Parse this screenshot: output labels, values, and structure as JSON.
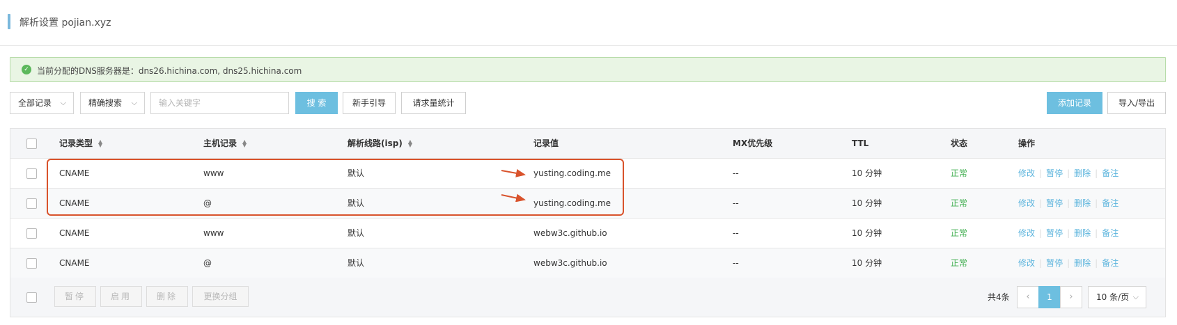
{
  "header": {
    "title": "解析设置 pojian.xyz"
  },
  "banner": {
    "text": "当前分配的DNS服务器是：dns26.hichina.com, dns25.hichina.com"
  },
  "toolbar": {
    "record_filter": "全部记录",
    "search_mode": "精确搜索",
    "search_placeholder": "输入关键字",
    "search_label": "搜 索",
    "guide_label": "新手引导",
    "stats_label": "请求量统计",
    "add_label": "添加记录",
    "import_export_label": "导入/导出"
  },
  "table": {
    "headers": {
      "type": "记录类型",
      "host": "主机记录",
      "line": "解析线路(isp)",
      "value": "记录值",
      "mx": "MX优先级",
      "ttl": "TTL",
      "status": "状态",
      "ops": "操作"
    },
    "ops_labels": {
      "edit": "修改",
      "pause": "暂停",
      "delete": "删除",
      "note": "备注"
    },
    "rows": [
      {
        "type": "CNAME",
        "host": "www",
        "line": "默认",
        "value": "yusting.coding.me",
        "mx": "--",
        "ttl": "10 分钟",
        "status": "正常"
      },
      {
        "type": "CNAME",
        "host": "@",
        "line": "默认",
        "value": "yusting.coding.me",
        "mx": "--",
        "ttl": "10 分钟",
        "status": "正常"
      },
      {
        "type": "CNAME",
        "host": "www",
        "line": "默认",
        "value": "webw3c.github.io",
        "mx": "--",
        "ttl": "10 分钟",
        "status": "正常"
      },
      {
        "type": "CNAME",
        "host": "@",
        "line": "默认",
        "value": "webw3c.github.io",
        "mx": "--",
        "ttl": "10 分钟",
        "status": "正常"
      }
    ]
  },
  "footer": {
    "pause_label": "暂停",
    "enable_label": "启用",
    "delete_label": "删除",
    "change_group_label": "更换分组",
    "total": "共4条",
    "current_page": "1",
    "page_size": "10 条/页"
  },
  "colors": {
    "accent": "#6dbfe0",
    "success": "#3fae4f",
    "annotation": "#d9532c",
    "link": "#5bb4dd"
  }
}
